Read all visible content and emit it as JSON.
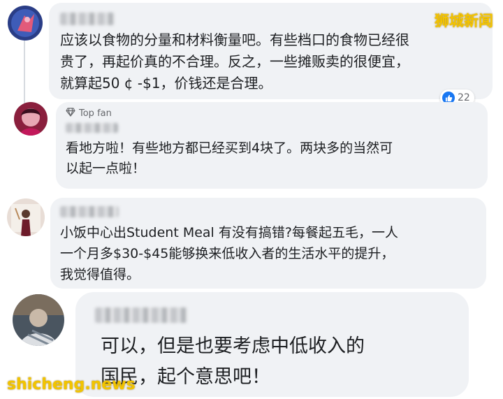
{
  "watermarks": {
    "top_right": "狮城新闻",
    "bottom_left": "shicheng.news"
  },
  "comments": [
    {
      "text": "应该以食物的分量和材料衡量吧。有些档口的食物已经很\n贵了，再起价真的不合理。反之，一些摊贩卖的很便宜，\n就算起50 ¢ -$1，价钱还是合理。",
      "reaction_icon": "like-icon",
      "reaction_count": "22"
    },
    {
      "badge": "Top fan",
      "badge_icon": "diamond-icon",
      "text": "看地方啦！有些地方都已经买到4块了。两块多的当然可\n以起一点啦！"
    },
    {
      "text": "小饭中心出Student Meal 有没有搞错?每餐起五毛，一人\n一个月多$30-$45能够换来低收入者的生活水平的提升，\n我觉得值得。"
    },
    {
      "text": "可以，但是也要考虑中低收入的\n国民，起个意思吧！"
    }
  ],
  "colors": {
    "bubble": "#f0f2f5",
    "like_blue": "#1877f2",
    "watermark": "#f2c400"
  }
}
